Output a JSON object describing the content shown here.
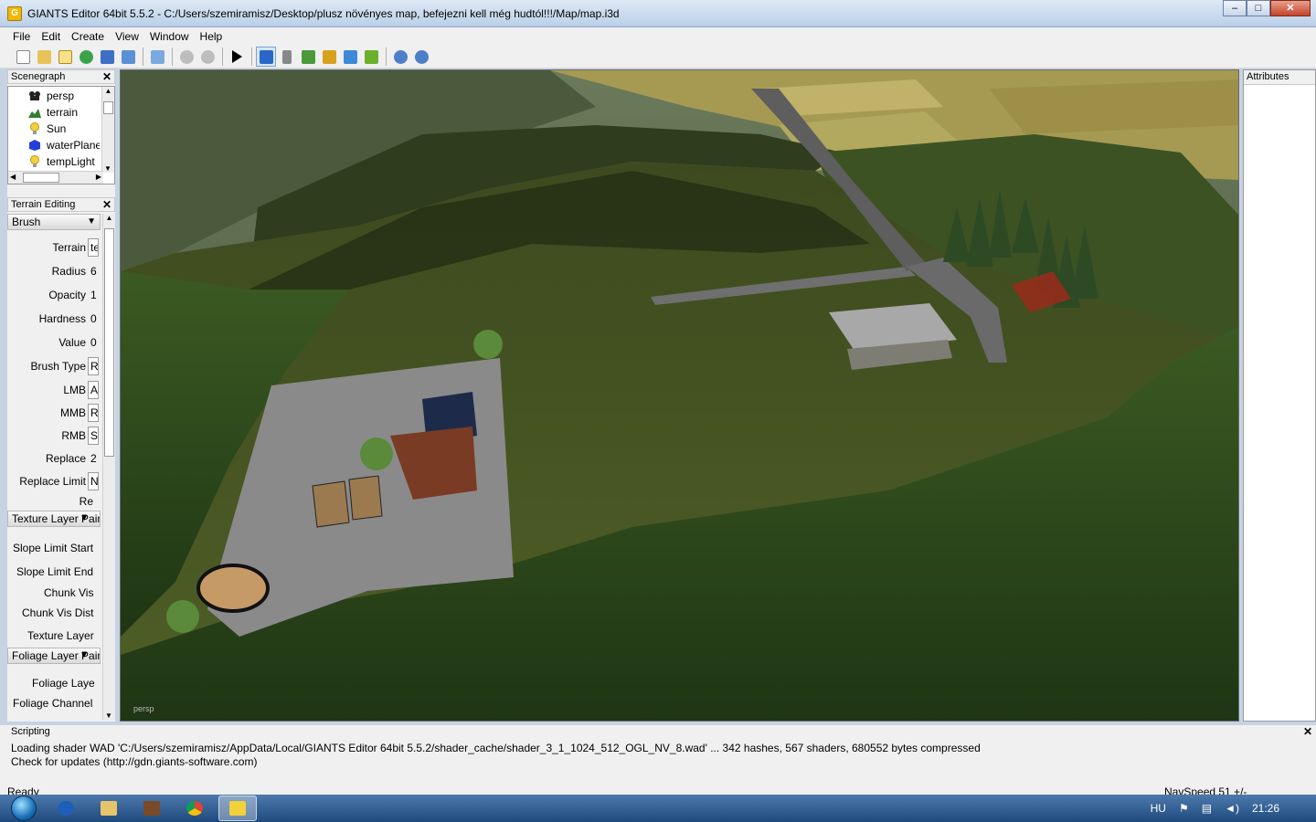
{
  "window": {
    "title": "GIANTS Editor 64bit 5.5.2 - C:/Users/szemiramisz/Desktop/plusz növényes map, befejezni kell még hudtól!!!/Map/map.i3d",
    "app_icon_letter": "G"
  },
  "menu": [
    "File",
    "Edit",
    "Create",
    "View",
    "Window",
    "Help"
  ],
  "toolbar": {
    "icons": [
      "new-file-icon",
      "open-folder-icon",
      "edit-icon",
      "refresh-icon",
      "save-icon",
      "export-icon",
      "import-icon",
      "undo-icon",
      "redo-icon",
      "play-icon",
      "home-icon",
      "magnet-icon",
      "terrain-sculpt-icon",
      "paint-icon",
      "foliage-icon",
      "settings-gear-icon",
      "settings-gear-2-icon"
    ]
  },
  "scenegraph": {
    "header": "Scenegraph",
    "items": [
      {
        "label": "persp",
        "icon": "camera-icon",
        "color": "#333333"
      },
      {
        "label": "terrain",
        "icon": "terrain-icon",
        "color": "#2e7d32"
      },
      {
        "label": "Sun",
        "icon": "light-icon",
        "color": "#f2d13a"
      },
      {
        "label": "waterPlane",
        "icon": "shape-icon",
        "color": "#2340d8"
      },
      {
        "label": "tempLight",
        "icon": "light-icon",
        "color": "#f2d13a"
      }
    ]
  },
  "terrain_editing": {
    "header": "Terrain Editing",
    "brush_section": "Brush",
    "fields": [
      {
        "label": "Terrain",
        "value": "te"
      },
      {
        "label": "Radius",
        "value": "6"
      },
      {
        "label": "Opacity",
        "value": "1"
      },
      {
        "label": "Hardness",
        "value": "0"
      },
      {
        "label": "Value",
        "value": "0"
      },
      {
        "label": "Brush Type",
        "value": "R"
      },
      {
        "label": "LMB",
        "value": "A"
      },
      {
        "label": "MMB",
        "value": "R"
      },
      {
        "label": "RMB",
        "value": "S"
      },
      {
        "label": "Replace",
        "value": "2"
      },
      {
        "label": "Replace Limit",
        "value": "N"
      },
      {
        "label": "Re",
        "value": ""
      }
    ],
    "texture_section": "Texture Layer Pain",
    "texture_fields": [
      "Slope Limit Start",
      "Slope Limit End",
      "Chunk Vis",
      "Chunk Vis Dist",
      "Texture Layer"
    ],
    "foliage_section": "Foliage Layer Pain",
    "foliage_fields": [
      "Foliage Laye",
      "Foliage Channel"
    ]
  },
  "viewport": {
    "camera_label": "persp"
  },
  "attributes": {
    "header": "Attributes"
  },
  "scripting": {
    "header": "Scripting",
    "lines": [
      "Loading shader WAD 'C:/Users/szemiramisz/AppData/Local/GIANTS Editor 64bit 5.5.2/shader_cache/shader_3_1_1024_512_OGL_NV_8.wad' ... 342 hashes, 567 shaders, 680552 bytes compressed",
      "Check for updates (http://gdn.giants-software.com)"
    ]
  },
  "status": {
    "left": "Ready",
    "right": "NavSpeed 51 +/-"
  },
  "taskbar": {
    "language": "HU",
    "clock": "21:26"
  }
}
